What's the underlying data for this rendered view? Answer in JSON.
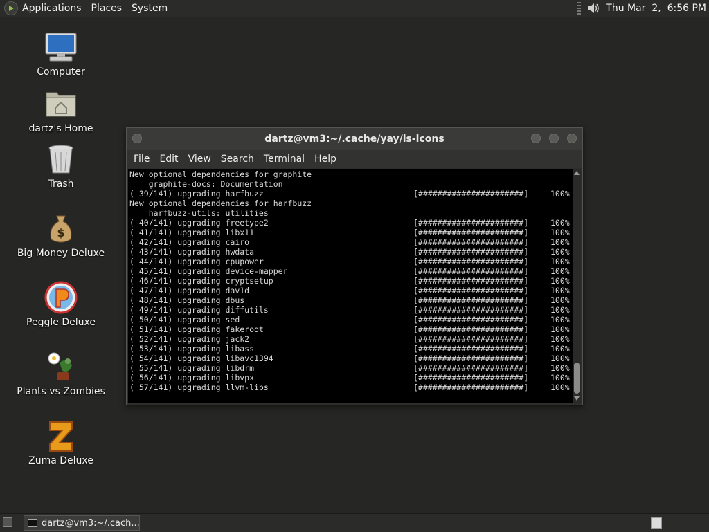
{
  "top_panel": {
    "menus": [
      "Applications",
      "Places",
      "System"
    ],
    "clock": "Thu Mar  2,  6:56 PM",
    "icons": [
      "distro-logo-icon",
      "volume-icon"
    ]
  },
  "desktop_icons": [
    {
      "label": "Computer",
      "icon": "computer-icon"
    },
    {
      "label": "dartz's Home",
      "icon": "home-folder-icon"
    },
    {
      "label": "Trash",
      "icon": "trash-icon"
    },
    {
      "label": "Big Money Deluxe",
      "icon": "money-bag-icon"
    },
    {
      "label": "Peggle Deluxe",
      "icon": "peggle-icon"
    },
    {
      "label": "Plants vs Zombies",
      "icon": "plants-vs-zombies-icon"
    },
    {
      "label": "Zuma Deluxe",
      "icon": "zuma-icon"
    }
  ],
  "window": {
    "title": "dartz@vm3:~/.cache/yay/ls-icons",
    "menu": [
      "File",
      "Edit",
      "View",
      "Search",
      "Terminal",
      "Help"
    ]
  },
  "terminal": {
    "bar": "[######################]",
    "percent": "100%",
    "lines": [
      {
        "text": "New optional dependencies for graphite",
        "progress": false
      },
      {
        "text": "    graphite-docs: Documentation",
        "progress": false
      },
      {
        "text": "( 39/141) upgrading harfbuzz",
        "progress": true
      },
      {
        "text": "New optional dependencies for harfbuzz",
        "progress": false
      },
      {
        "text": "    harfbuzz-utils: utilities",
        "progress": false
      },
      {
        "text": "( 40/141) upgrading freetype2",
        "progress": true
      },
      {
        "text": "( 41/141) upgrading libx11",
        "progress": true
      },
      {
        "text": "( 42/141) upgrading cairo",
        "progress": true
      },
      {
        "text": "( 43/141) upgrading hwdata",
        "progress": true
      },
      {
        "text": "( 44/141) upgrading cpupower",
        "progress": true
      },
      {
        "text": "( 45/141) upgrading device-mapper",
        "progress": true
      },
      {
        "text": "( 46/141) upgrading cryptsetup",
        "progress": true
      },
      {
        "text": "( 47/141) upgrading dav1d",
        "progress": true
      },
      {
        "text": "( 48/141) upgrading dbus",
        "progress": true
      },
      {
        "text": "( 49/141) upgrading diffutils",
        "progress": true
      },
      {
        "text": "( 50/141) upgrading sed",
        "progress": true
      },
      {
        "text": "( 51/141) upgrading fakeroot",
        "progress": true
      },
      {
        "text": "( 52/141) upgrading jack2",
        "progress": true
      },
      {
        "text": "( 53/141) upgrading libass",
        "progress": true
      },
      {
        "text": "( 54/141) upgrading libavc1394",
        "progress": true
      },
      {
        "text": "( 55/141) upgrading libdrm",
        "progress": true
      },
      {
        "text": "( 56/141) upgrading libvpx",
        "progress": true
      },
      {
        "text": "( 57/141) upgrading llvm-libs",
        "progress": true
      }
    ]
  },
  "taskbar": {
    "task_label": "dartz@vm3:~/.cach..."
  }
}
